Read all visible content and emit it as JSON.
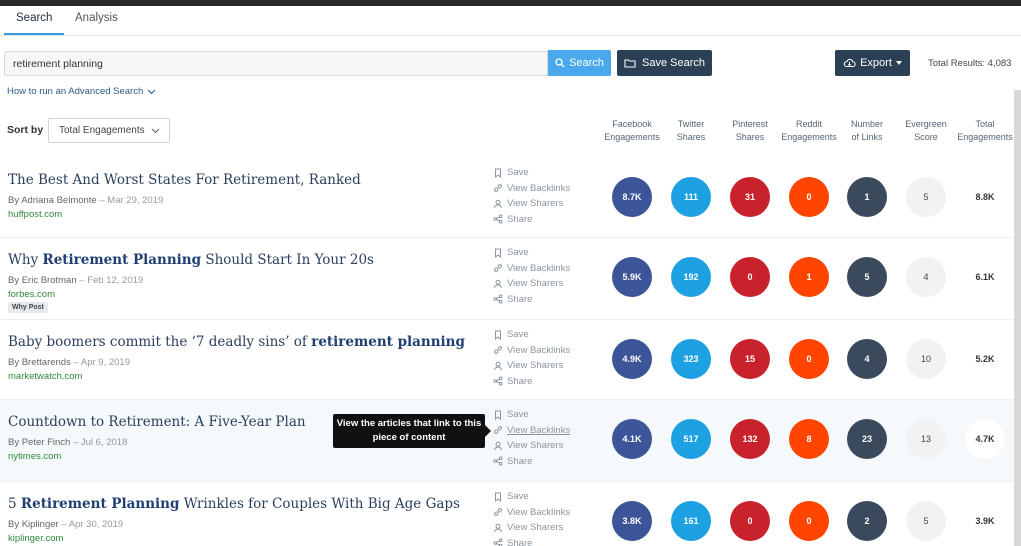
{
  "tabs": [
    {
      "label": "Search",
      "active": true
    },
    {
      "label": "Analysis",
      "active": false
    }
  ],
  "search": {
    "value": "retirement planning",
    "button_label": "Search",
    "save_label": "Save Search"
  },
  "export_label": "Export",
  "total_results": "Total Results: 4,083",
  "advanced_link": "How to run an Advanced Search",
  "sort": {
    "label": "Sort by",
    "value": "Total Engagements"
  },
  "columns": [
    {
      "l1": "Facebook",
      "l2": "Engagements"
    },
    {
      "l1": "Twitter",
      "l2": "Shares"
    },
    {
      "l1": "Pinterest",
      "l2": "Shares"
    },
    {
      "l1": "Reddit",
      "l2": "Engagements"
    },
    {
      "l1": "Number",
      "l2": "of Links"
    },
    {
      "l1": "Evergreen",
      "l2": "Score"
    },
    {
      "l1": "Total",
      "l2": "Engagements"
    }
  ],
  "actions": {
    "save": "Save",
    "backlinks": "View Backlinks",
    "sharers": "View Sharers",
    "share": "Share"
  },
  "tooltip": "View the articles that link to this piece of content",
  "colors": {
    "facebook": "#3b5598",
    "twitter": "#1da1e2",
    "pinterest": "#c8232c",
    "reddit": "#ff4500",
    "links": "#3a4a5c",
    "evergreen": "#f1f2f3",
    "accent": "#4aa9ec",
    "dark_button": "#2b3f55"
  },
  "results": [
    {
      "title_parts": [
        {
          "t": "The Best And Worst States For Retirement, Ranked",
          "b": false
        }
      ],
      "author": "By Adriana Belmonte",
      "date": "– Mar 29, 2019",
      "domain": "huffpost.com",
      "badge": "",
      "facebook": "8.7K",
      "twitter": "111",
      "pinterest": "31",
      "reddit": "0",
      "links": "1",
      "evergreen": "5",
      "total": "8.8K"
    },
    {
      "title_parts": [
        {
          "t": "Why ",
          "b": false
        },
        {
          "t": "Retirement Planning",
          "b": true
        },
        {
          "t": " Should Start In Your 20s",
          "b": false
        }
      ],
      "author": "By Eric Brotman",
      "date": "– Feb 12, 2019",
      "domain": "forbes.com",
      "badge": "Why Post",
      "facebook": "5.9K",
      "twitter": "192",
      "pinterest": "0",
      "reddit": "1",
      "links": "5",
      "evergreen": "4",
      "total": "6.1K"
    },
    {
      "title_parts": [
        {
          "t": "Baby boomers commit the ‘7 deadly sins’ of ",
          "b": false
        },
        {
          "t": "retirement planning",
          "b": true
        }
      ],
      "author": "By Brettarends",
      "date": "– Apr 9, 2019",
      "domain": "marketwatch.com",
      "badge": "",
      "facebook": "4.9K",
      "twitter": "323",
      "pinterest": "15",
      "reddit": "0",
      "links": "4",
      "evergreen": "10",
      "total": "5.2K"
    },
    {
      "title_parts": [
        {
          "t": "Countdown to Retirement: A Five-Year Plan",
          "b": false
        }
      ],
      "author": "By Peter Finch",
      "date": "– Jul 6, 2018",
      "domain": "nytimes.com",
      "badge": "",
      "facebook": "4.1K",
      "twitter": "517",
      "pinterest": "132",
      "reddit": "8",
      "links": "23",
      "evergreen": "13",
      "total": "4.7K"
    },
    {
      "title_parts": [
        {
          "t": "5 ",
          "b": false
        },
        {
          "t": "Retirement Planning",
          "b": true
        },
        {
          "t": " Wrinkles for Couples With Big Age Gaps",
          "b": false
        }
      ],
      "author": "By Kiplinger",
      "date": "– Apr 30, 2019",
      "domain": "kiplinger.com",
      "badge": "",
      "facebook": "3.8K",
      "twitter": "161",
      "pinterest": "0",
      "reddit": "0",
      "links": "2",
      "evergreen": "5",
      "total": "3.9K"
    }
  ]
}
